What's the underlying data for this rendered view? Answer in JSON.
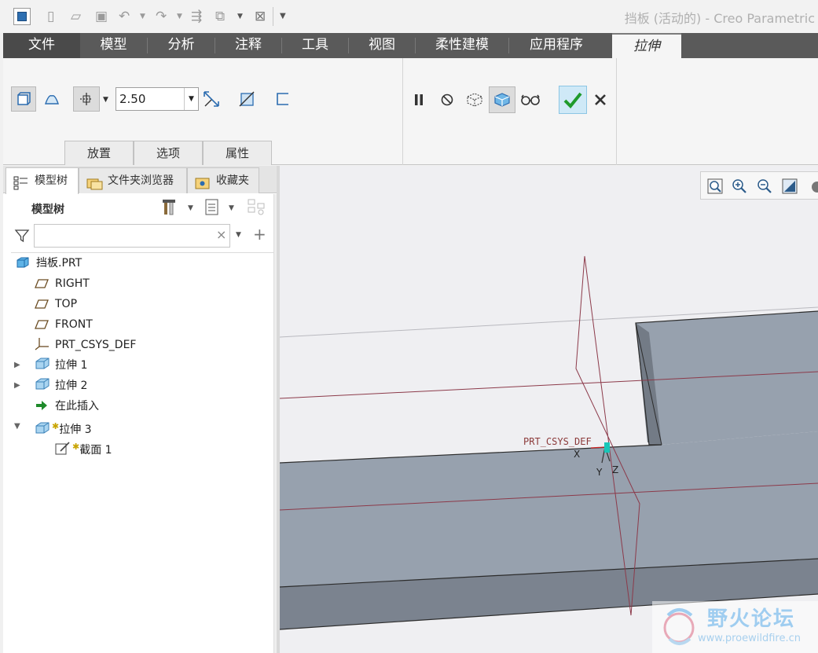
{
  "window": {
    "title": "挡板 (活动的) - Creo Parametric"
  },
  "quick_access": {
    "icons": [
      "new-file-icon",
      "open-file-icon",
      "save-icon",
      "undo-icon",
      "redo-icon",
      "regenerate-icon",
      "switch-window-icon",
      "close-window-icon",
      "customize-icon"
    ]
  },
  "ribbon_tabs": [
    {
      "label": "文件"
    },
    {
      "label": "模型"
    },
    {
      "label": "分析"
    },
    {
      "label": "注释"
    },
    {
      "label": "工具"
    },
    {
      "label": "视图"
    },
    {
      "label": "柔性建模"
    },
    {
      "label": "应用程序"
    },
    {
      "label": "拉伸"
    }
  ],
  "extrude_dashboard": {
    "depth_value": "2.50",
    "subtabs": [
      {
        "label": "放置"
      },
      {
        "label": "选项"
      },
      {
        "label": "属性"
      }
    ],
    "icons": [
      "solid-extrude-icon",
      "surface-extrude-icon",
      "blind-depth-icon",
      "flip-direction-icon",
      "remove-material-icon",
      "thicken-icon",
      "pause-icon",
      "no-preview-icon",
      "attach-preview-icon",
      "verify-preview-icon",
      "glasses-icon",
      "confirm-check-icon",
      "cancel-x-icon"
    ],
    "colors": {
      "confirm_bg": "#cfe9f7",
      "confirm_check": "#1f9a2b"
    }
  },
  "navigator": {
    "tabs": [
      {
        "label": "模型树",
        "icon": "model-tree-icon"
      },
      {
        "label": "文件夹浏览器",
        "icon": "folder-browser-icon"
      },
      {
        "label": "收藏夹",
        "icon": "favorites-icon"
      }
    ],
    "tree_title": "模型树",
    "filter_placeholder": ""
  },
  "model_tree": {
    "root": "挡板.PRT",
    "items": [
      {
        "label": "RIGHT",
        "icon": "datum-plane-icon"
      },
      {
        "label": "TOP",
        "icon": "datum-plane-icon"
      },
      {
        "label": "FRONT",
        "icon": "datum-plane-icon"
      },
      {
        "label": "PRT_CSYS_DEF",
        "icon": "csys-icon"
      },
      {
        "label": "拉伸 1",
        "icon": "extrude-feature-icon"
      },
      {
        "label": "拉伸 2",
        "icon": "extrude-feature-icon"
      },
      {
        "label": "在此插入",
        "icon": "insert-here-arrow-icon"
      },
      {
        "label": "拉伸 3",
        "icon": "extrude-feature-icon"
      },
      {
        "label": "截面 1",
        "icon": "sketch-section-icon"
      }
    ]
  },
  "viewport": {
    "csys_label": "PRT_CSYS_DEF",
    "axis_labels": {
      "x": "X",
      "y": "Y",
      "z": "Z"
    },
    "colors": {
      "background": "#efeff2",
      "part_top": "#97a1ae",
      "part_side": "#7b838f",
      "datum": "#8c3a4a"
    }
  },
  "watermark": {
    "name": "野火论坛",
    "url": "www.proewildfire.cn"
  }
}
